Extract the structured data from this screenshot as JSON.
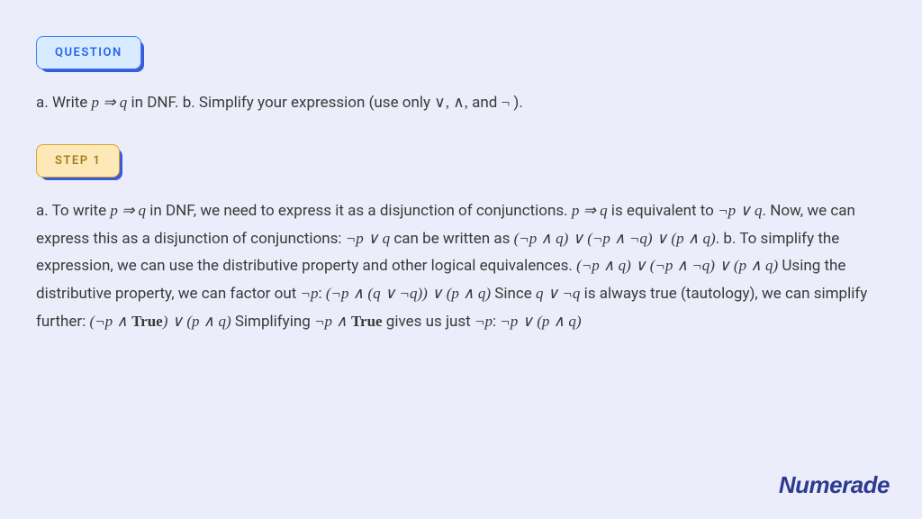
{
  "badges": {
    "question": "QUESTION",
    "step1": "STEP 1"
  },
  "question": {
    "a_prefix": "a. Write ",
    "expr_pq": "p ⇒ q",
    "a_suffix": " in DNF. b. Simplify your expression (use only ",
    "ops": "∨, ∧,",
    "and": " and ",
    "neg": "¬",
    "close": " )."
  },
  "step1": {
    "s1": "a. To write ",
    "e1": "p ⇒ q",
    "s2": " in DNF, we need to express it as a disjunction of conjunctions. ",
    "e2": "p ⇒ q",
    "s3": " is equivalent to ",
    "e3": "¬p ∨ q",
    "s4": ". Now, we can express this as a disjunction of conjunctions: ",
    "e4": "¬p ∨ q",
    "s5": " can be written as ",
    "e5": "(¬p ∧ q) ∨ (¬p ∧ ¬q) ∨ (p ∧ q)",
    "s6": ". b. To simplify the expression, we can use the distributive property and other logical equivalences. ",
    "e6": "(¬p ∧ q) ∨ (¬p ∧ ¬q) ∨ (p ∧ q)",
    "s7": " Using the distributive property, we can factor out ",
    "e7": "¬p",
    "s8": ": ",
    "e8": "(¬p ∧ (q ∨ ¬q)) ∨ (p ∧ q)",
    "s9": " Since ",
    "e9": "q ∨ ¬q",
    "s10": " is always true (tautology), we can simplify further: ",
    "e10": "(¬p ∧ True) ∨ (p ∧ q)",
    "s11": " Simplifying ",
    "e11": "¬p ∧ True",
    "s12": " gives us just ",
    "e12": "¬p",
    "s13": ": ",
    "e13": "¬p ∨ (p ∧ q)"
  },
  "brand": "Numerade"
}
